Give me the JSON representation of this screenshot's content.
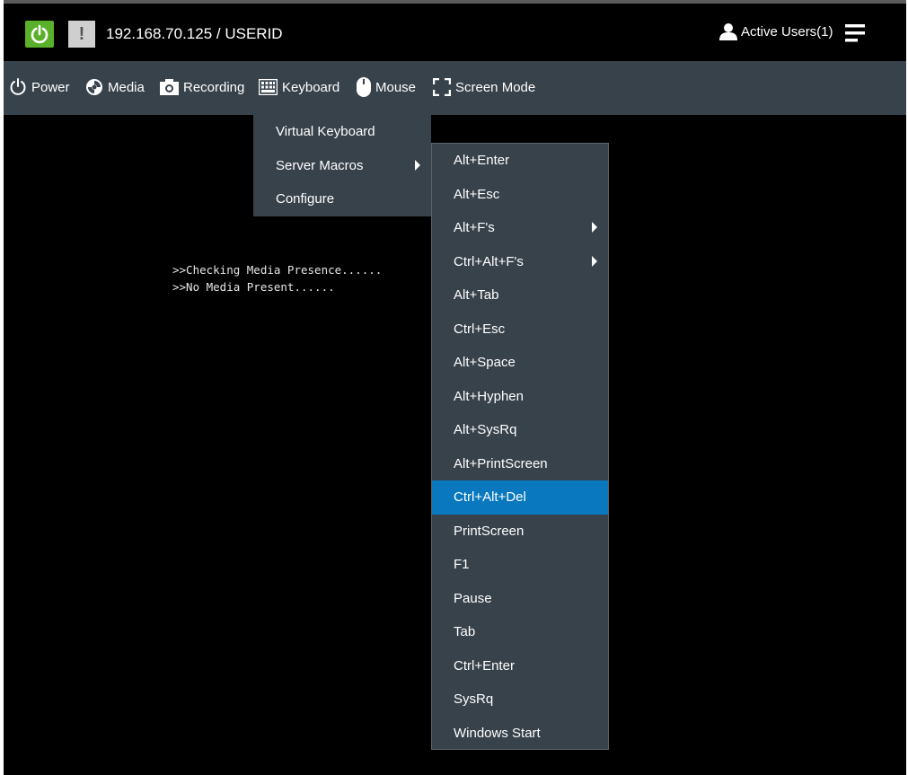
{
  "header": {
    "host_label": "192.168.70.125 / USERID",
    "active_users_label": "Active Users(1)",
    "warning_glyph": "!",
    "power_color": "#5ab02a"
  },
  "nav": {
    "items": [
      {
        "label": "Power",
        "icon": "power-icon"
      },
      {
        "label": "Media",
        "icon": "media-disc-icon"
      },
      {
        "label": "Recording",
        "icon": "camera-icon"
      },
      {
        "label": "Keyboard",
        "icon": "keyboard-icon"
      },
      {
        "label": "Mouse",
        "icon": "mouse-icon"
      },
      {
        "label": "Screen Mode",
        "icon": "fullscreen-icon"
      }
    ]
  },
  "console": {
    "lines": [
      ">>Checking Media Presence......",
      ">>No Media Present......"
    ]
  },
  "keyboard_menu": {
    "items": [
      "Virtual Keyboard",
      "Server Macros",
      "Configure"
    ]
  },
  "server_macros": {
    "items": [
      "Alt+Enter",
      "Alt+Esc",
      "Alt+F's",
      "Ctrl+Alt+F's",
      "Alt+Tab",
      "Ctrl+Esc",
      "Alt+Space",
      "Alt+Hyphen",
      "Alt+SysRq",
      "Alt+PrintScreen",
      "Ctrl+Alt+Del",
      "PrintScreen",
      "F1",
      "Pause",
      "Tab",
      "Ctrl+Enter",
      "SysRq",
      "Windows Start"
    ],
    "highlighted": "Ctrl+Alt+Del",
    "highlight_color": "#0a78bf"
  }
}
